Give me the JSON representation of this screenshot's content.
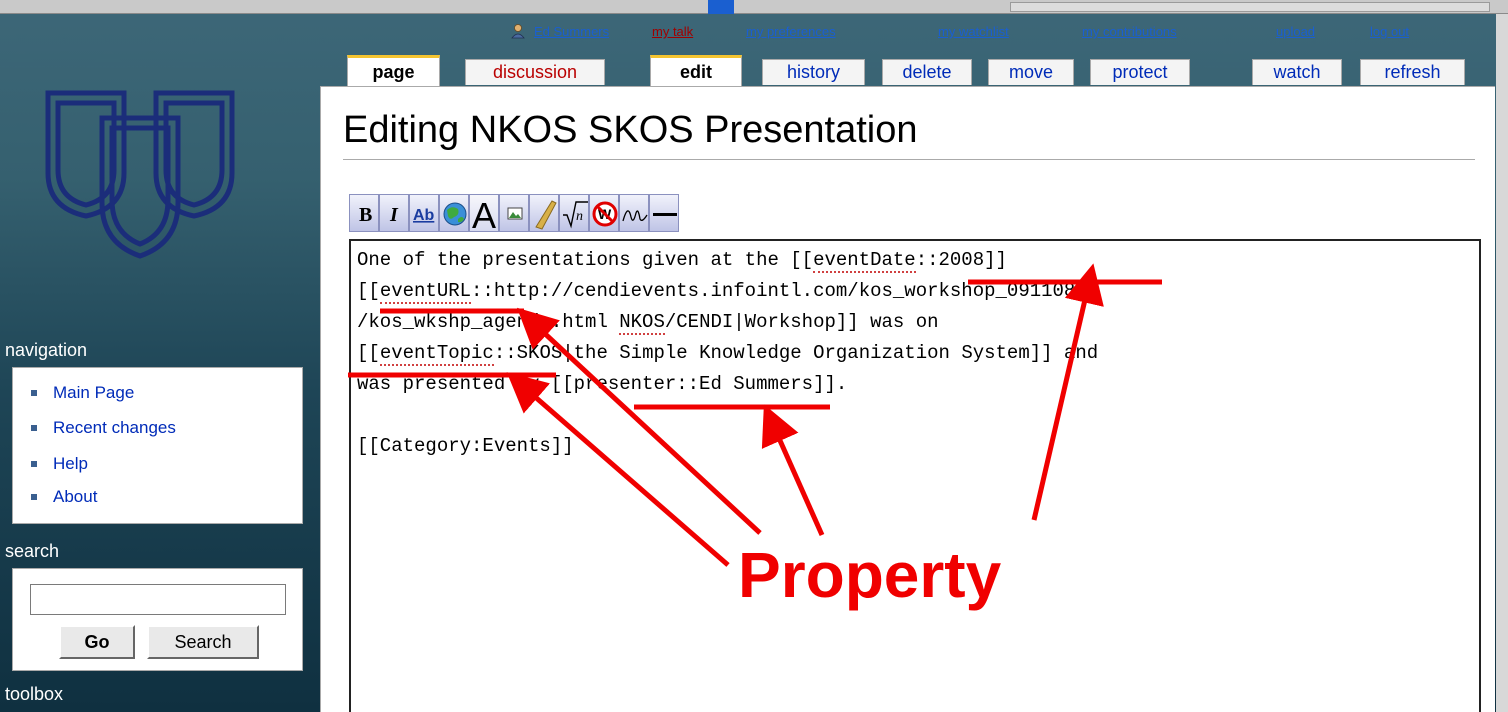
{
  "personal_tools": {
    "user": "Ed Summers",
    "talk": "my talk",
    "preferences": "my preferences",
    "watchlist": "my watchlist",
    "contributions": "my contributions",
    "upload": "upload",
    "logout": "log out"
  },
  "tabs": [
    {
      "label": "page",
      "state": "selected"
    },
    {
      "label": "discussion",
      "state": "new"
    },
    {
      "label": "edit",
      "state": "selected"
    },
    {
      "label": "history"
    },
    {
      "label": "delete"
    },
    {
      "label": "move"
    },
    {
      "label": "protect"
    },
    {
      "label": "watch"
    },
    {
      "label": "refresh"
    }
  ],
  "heading": "Editing NKOS SKOS Presentation",
  "toolbar": {
    "buttons": [
      "bold-icon",
      "italic-icon",
      "internal-link-icon",
      "external-link-icon",
      "headline-icon",
      "image-icon",
      "media-icon",
      "math-icon",
      "nowiki-icon",
      "signature-icon",
      "horizontal-rule-icon"
    ],
    "bold_glyph": "B",
    "italic_glyph": "I",
    "link_glyph": "Ab",
    "headline_glyph": "A"
  },
  "editor": {
    "l1_a": "One of the presentations given at the [[",
    "l1_prop": "eventDate",
    "l1_b": "::2008]]",
    "l2_a": "[[",
    "l2_prop": "eventURL",
    "l2_b": "::http://cendievents.infointl.com/kos_workshop_091108",
    "l3_a": "/kos_wkshp_agenda.html ",
    "l3_prop": "NKOS",
    "l3_b": "/CENDI|Workshop]] was on",
    "l4_a": "[[",
    "l4_prop": "eventTopic",
    "l4_b": "::SKOS|the Simple Knowledge Organization System]] and",
    "l5": "was presented by [[presenter::Ed Summers]].",
    "l7": "[[Category:Events]]"
  },
  "sidebar": {
    "navigation_title": "navigation",
    "nav_items": [
      "Main Page",
      "Recent changes",
      "Help",
      "About"
    ],
    "search_title": "search",
    "search_value": "",
    "go_button": "Go",
    "search_button": "Search",
    "toolbox_title": "toolbox"
  },
  "annotation": {
    "label": "Property",
    "color": "#f00000"
  },
  "colors": {
    "link": "#002bb8",
    "new_link": "#ba0000",
    "tab_accent": "#f4c430"
  }
}
